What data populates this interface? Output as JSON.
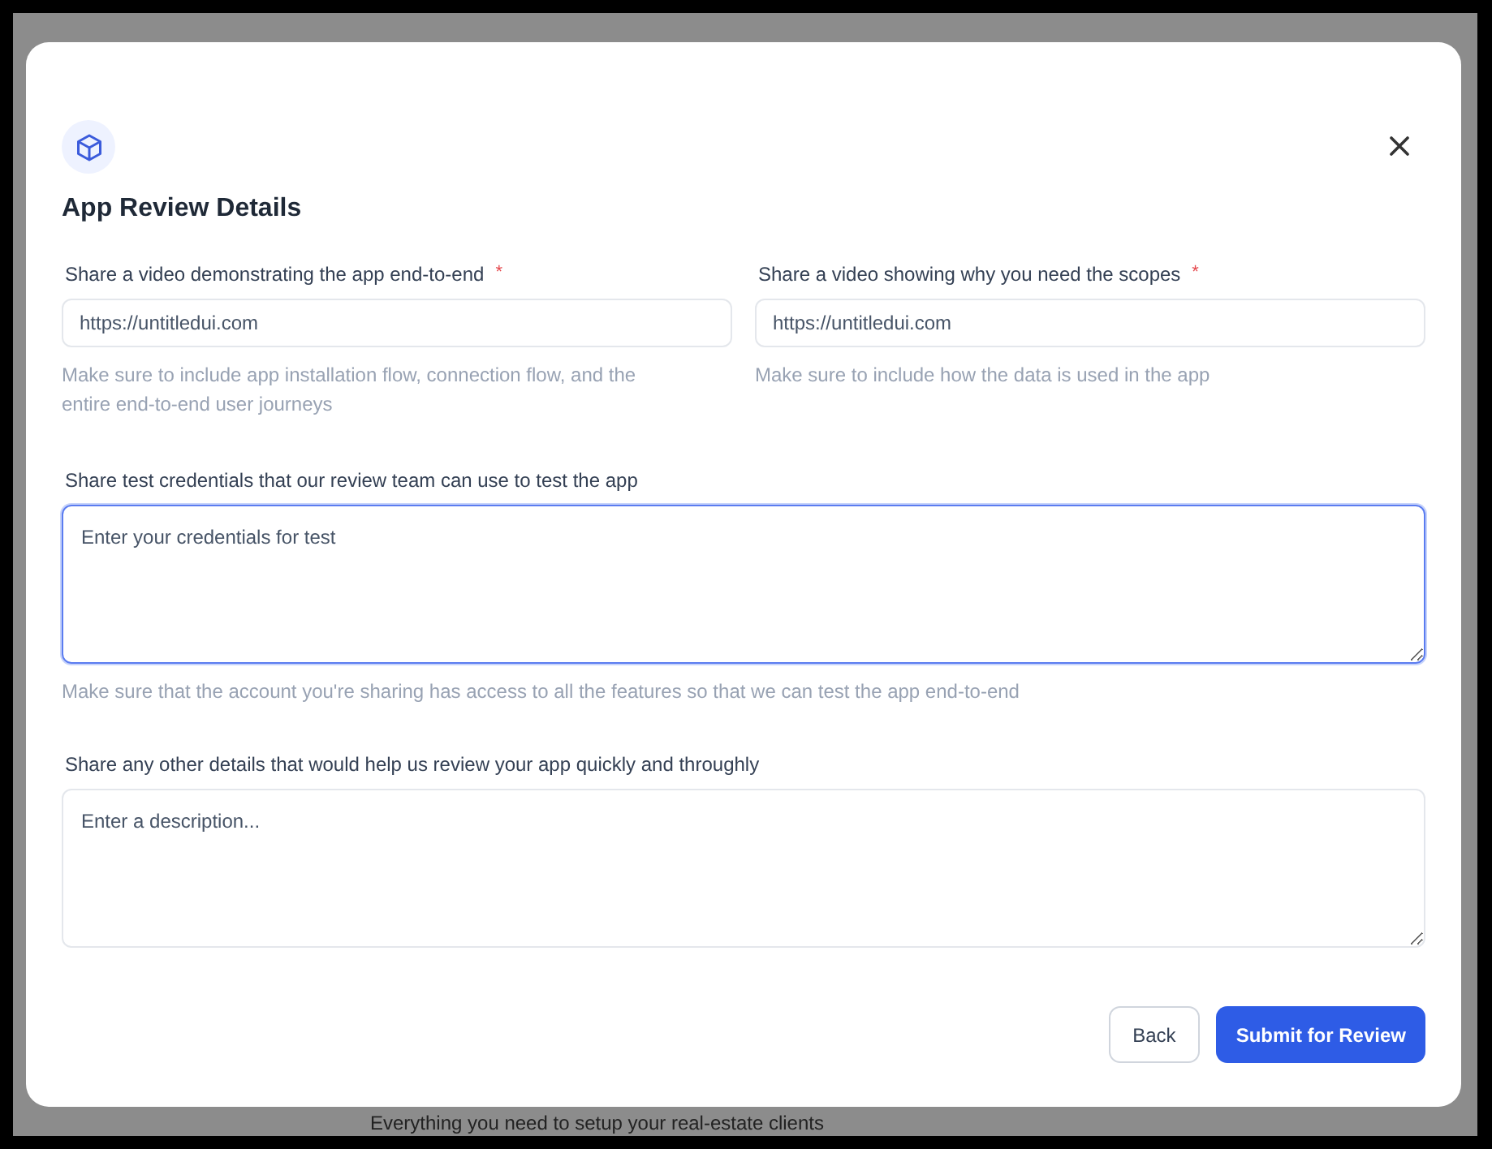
{
  "background": {
    "text": "Everything you need to setup your real-estate clients"
  },
  "dialog": {
    "title": "App Review Details",
    "fields": [
      {
        "kind": "input",
        "label": "Share a video demonstrating the app end-to-end",
        "required_mark": "*",
        "placeholder": "https://untitledui.com",
        "hint": "Make sure to include app installation flow, connection flow, and the entire end-to-end user journeys",
        "focused": false
      },
      {
        "kind": "input",
        "label": "Share a video showing why you need the scopes",
        "required_mark": "*",
        "placeholder": "https://untitledui.com",
        "hint": "Make sure to include how the data is used in the app",
        "focused": false
      },
      {
        "kind": "textarea",
        "label": "Share test credentials that our review team can use to test the app",
        "placeholder": "Enter your credentials for test",
        "hint": "Make sure that the account you're sharing has access to all the features so that we can test the app end-to-end",
        "focused": true
      },
      {
        "kind": "textarea",
        "label": "Share any other details that would help us review your app quickly and throughly",
        "placeholder": "Enter a description...",
        "focused": false
      }
    ],
    "buttons": [
      {
        "label": "Back",
        "kind": "secondary"
      },
      {
        "label": "Submit for Review",
        "kind": "primary"
      }
    ]
  }
}
